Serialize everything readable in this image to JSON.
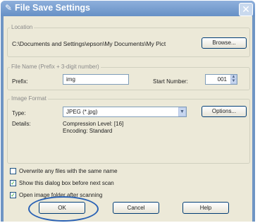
{
  "window": {
    "title": "File Save Settings",
    "close_glyph": "✕",
    "icon": "app-icon"
  },
  "location": {
    "legend": "Location",
    "path": "C:\\Documents and Settings\\epson\\My Documents\\My Pict",
    "browse_label": "Browse..."
  },
  "file_name": {
    "legend": "File Name (Prefix + 3-digit number)",
    "prefix_label": "Prefix:",
    "prefix_value": "img",
    "start_number_label": "Start Number:",
    "start_number_value": "001"
  },
  "image_format": {
    "legend": "Image Format",
    "type_label": "Type:",
    "type_value": "JPEG (*.jpg)",
    "options_label": "Options...",
    "details_label": "Details:",
    "details_line1": "Compression Level: [16]",
    "details_line2": "Encoding: Standard"
  },
  "checkboxes": [
    {
      "label": "Overwrite any files with the same name",
      "checked": false
    },
    {
      "label": "Show this dialog box before next scan",
      "checked": true
    },
    {
      "label": "Open image folder after scanning",
      "checked": true
    }
  ],
  "buttons": {
    "ok": "OK",
    "cancel": "Cancel",
    "help": "Help"
  },
  "colors": {
    "title_bar": "#6f95c4",
    "dialog_bg": "#ece9d8",
    "highlight_oval": "#2a62b5"
  }
}
